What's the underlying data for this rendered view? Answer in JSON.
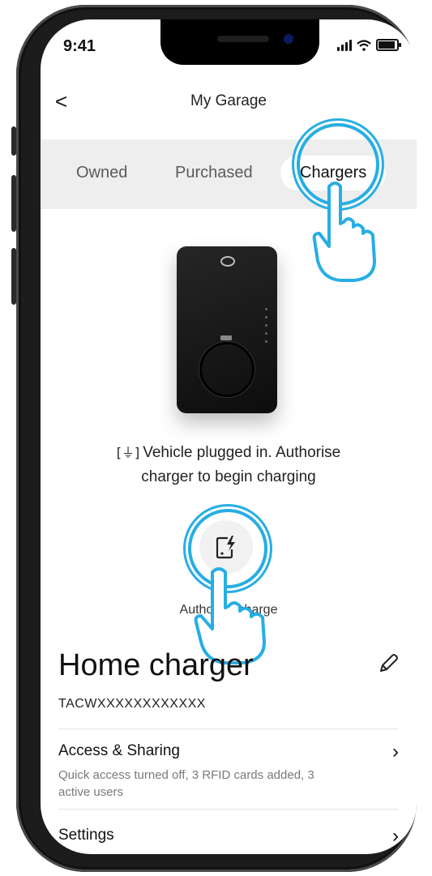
{
  "status_bar": {
    "time": "9:41"
  },
  "nav": {
    "back_label": "<",
    "title": "My Garage"
  },
  "tabs": [
    {
      "label": "Owned",
      "active": false
    },
    {
      "label": "Purchased",
      "active": false
    },
    {
      "label": "Chargers",
      "active": true
    }
  ],
  "charger": {
    "status_icon": "plug-icon",
    "status_message_line1": "Vehicle plugged in. Authorise",
    "status_message_line2": "charger to begin charging",
    "authorise_label": "Authorise charge",
    "authorise_icon": "phone-charge-icon"
  },
  "home_charger": {
    "title": "Home charger",
    "serial": "TACWXXXXXXXXXXXX"
  },
  "rows": [
    {
      "title": "Access & Sharing",
      "subtitle": "Quick access turned off, 3 RFID cards added, 3 active users"
    },
    {
      "title": "Settings"
    }
  ],
  "colors": {
    "highlight": "#27aee3",
    "tab_bg": "#eeeeee"
  }
}
